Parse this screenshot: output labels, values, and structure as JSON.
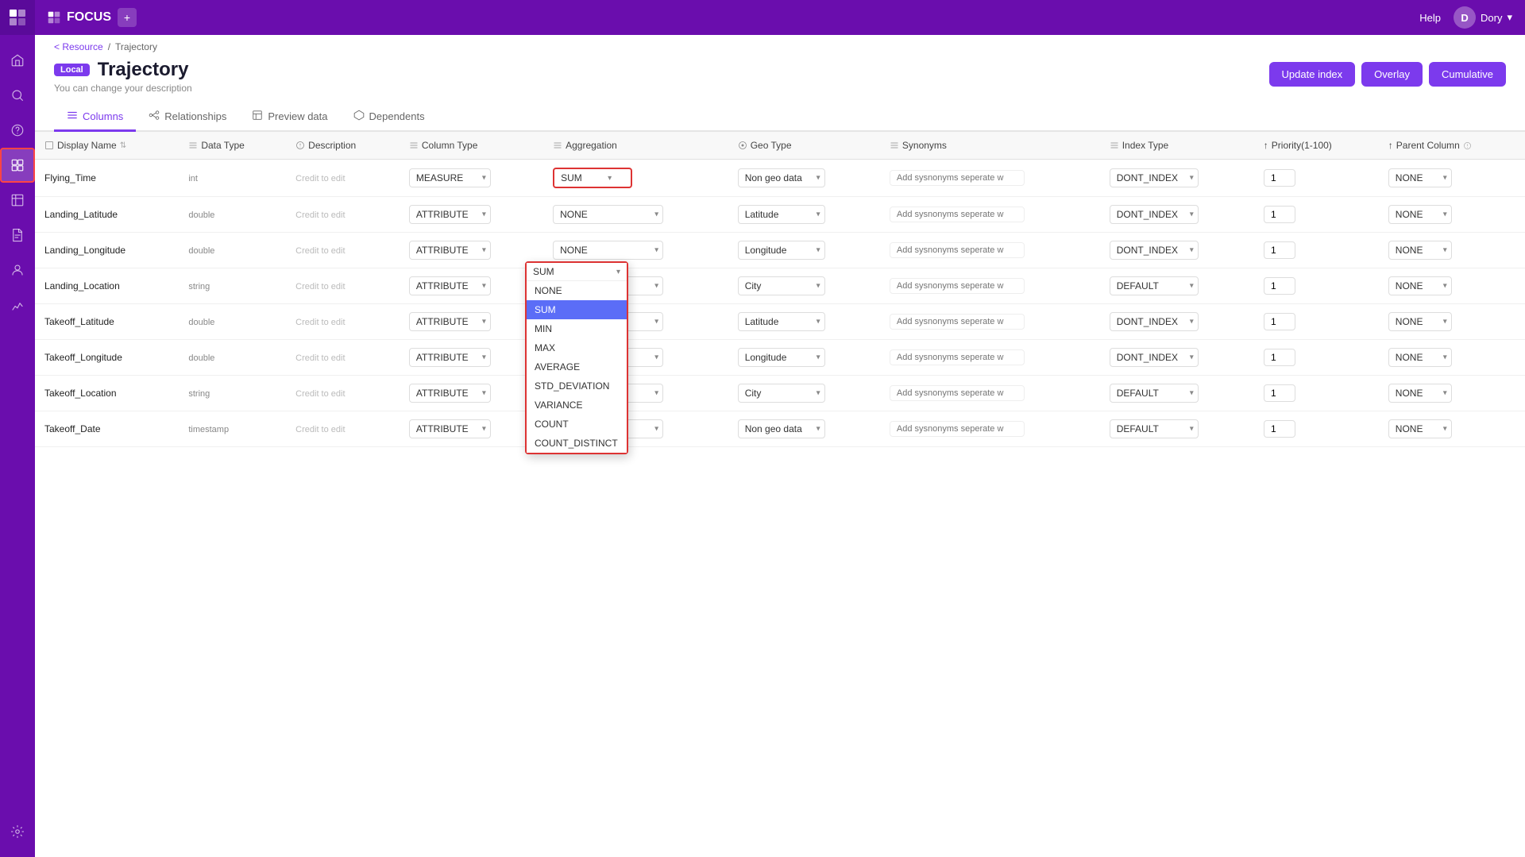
{
  "app": {
    "name": "FOCUS",
    "new_tab_label": "+",
    "help_label": "Help",
    "user_label": "Dory",
    "chevron": "▾"
  },
  "breadcrumb": {
    "back_label": "< Resource",
    "separator": "/",
    "current": "Trajectory"
  },
  "page": {
    "badge": "Local",
    "title": "Trajectory",
    "subtitle": "You can change your description",
    "update_button": "Update index",
    "overlay_button": "Overlay",
    "cumulative_button": "Cumulative"
  },
  "tabs": [
    {
      "id": "columns",
      "label": "Columns",
      "icon": "≡",
      "active": true
    },
    {
      "id": "relationships",
      "label": "Relationships",
      "icon": "⊹",
      "active": false
    },
    {
      "id": "preview",
      "label": "Preview data",
      "icon": "□",
      "active": false
    },
    {
      "id": "dependents",
      "label": "Dependents",
      "icon": "⬡",
      "active": false
    }
  ],
  "table": {
    "columns": [
      {
        "key": "display_name",
        "label": "Display Name",
        "icon": "□",
        "sortable": true
      },
      {
        "key": "data_type",
        "label": "Data Type",
        "icon": "≡"
      },
      {
        "key": "description",
        "label": "Description",
        "icon": "?"
      },
      {
        "key": "column_type",
        "label": "Column Type",
        "icon": "≡"
      },
      {
        "key": "aggregation",
        "label": "Aggregation",
        "icon": "≡"
      },
      {
        "key": "geo_type",
        "label": "Geo Type",
        "icon": "●"
      },
      {
        "key": "synonyms",
        "label": "Synonyms",
        "icon": "≡"
      },
      {
        "key": "index_type",
        "label": "Index Type",
        "icon": "≡"
      },
      {
        "key": "priority",
        "label": "Priority(1-100)",
        "icon": "↑"
      },
      {
        "key": "parent_column",
        "label": "Parent Column",
        "icon": "↑"
      }
    ],
    "rows": [
      {
        "display_name": "Flying_Time",
        "data_type": "int",
        "description": "Credit to edit",
        "column_type": "MEASURE",
        "aggregation": "SUM",
        "aggregation_open": true,
        "geo_type": "Non geo data",
        "synonyms_placeholder": "Add sysnonyms seperate w",
        "index_type": "DONT_INDEX",
        "priority": "1",
        "parent_column": "NONE"
      },
      {
        "display_name": "Landing_Latitude",
        "data_type": "double",
        "description": "Credit to edit",
        "column_type": "ATTRIBUTE",
        "aggregation": "NONE",
        "aggregation_open": false,
        "geo_type": "Latitude",
        "synonyms_placeholder": "Add sysnonyms seperate w",
        "index_type": "DONT_INDEX",
        "priority": "1",
        "parent_column": "NONE"
      },
      {
        "display_name": "Landing_Longitude",
        "data_type": "double",
        "description": "Credit to edit",
        "column_type": "ATTRIBUTE",
        "aggregation": "NONE",
        "aggregation_open": false,
        "geo_type": "Longitude",
        "synonyms_placeholder": "Add sysnonyms seperate w",
        "index_type": "DONT_INDEX",
        "priority": "1",
        "parent_column": "NONE"
      },
      {
        "display_name": "Landing_Location",
        "data_type": "string",
        "description": "Credit to edit",
        "column_type": "ATTRIBUTE",
        "aggregation": "NONE",
        "aggregation_open": false,
        "geo_type": "City",
        "synonyms_placeholder": "Add sysnonyms seperate w",
        "index_type": "DEFAULT",
        "priority": "1",
        "parent_column": "NONE"
      },
      {
        "display_name": "Takeoff_Latitude",
        "data_type": "double",
        "description": "Credit to edit",
        "column_type": "ATTRIBUTE",
        "aggregation": "NONE",
        "aggregation_open": false,
        "geo_type": "Latitude",
        "synonyms_placeholder": "Add sysnonyms seperate w",
        "index_type": "DONT_INDEX",
        "priority": "1",
        "parent_column": "NONE"
      },
      {
        "display_name": "Takeoff_Longitude",
        "data_type": "double",
        "description": "Credit to edit",
        "column_type": "ATTRIBUTE",
        "aggregation": "NONE",
        "aggregation_open": false,
        "geo_type": "Longitude",
        "synonyms_placeholder": "Add sysnonyms seperate w",
        "index_type": "DONT_INDEX",
        "priority": "1",
        "parent_column": "NONE"
      },
      {
        "display_name": "Takeoff_Location",
        "data_type": "string",
        "description": "Credit to edit",
        "column_type": "ATTRIBUTE",
        "aggregation": "NONE",
        "aggregation_open": false,
        "geo_type": "City",
        "synonyms_placeholder": "Add sysnonyms seperate w",
        "index_type": "DEFAULT",
        "priority": "1",
        "parent_column": "NONE"
      },
      {
        "display_name": "Takeoff_Date",
        "data_type": "timestamp",
        "description": "Credit to edit",
        "column_type": "ATTRIBUTE",
        "aggregation": "NONE",
        "aggregation_open": false,
        "geo_type": "Non geo data",
        "synonyms_placeholder": "Add sysnonyms seperate w",
        "index_type": "DEFAULT",
        "priority": "1",
        "parent_column": "NONE"
      }
    ],
    "aggregation_options": [
      "NONE",
      "SUM",
      "MIN",
      "MAX",
      "AVERAGE",
      "STD_DEVIATION",
      "VARIANCE",
      "COUNT",
      "COUNT_DISTINCT"
    ]
  },
  "sidebar": {
    "icons": [
      {
        "id": "home",
        "symbol": "⌂",
        "active": false
      },
      {
        "id": "search",
        "symbol": "🔍",
        "active": false
      },
      {
        "id": "help",
        "symbol": "?",
        "active": false
      },
      {
        "id": "datasets",
        "symbol": "▦",
        "active": true
      },
      {
        "id": "library",
        "symbol": "📋",
        "active": false
      },
      {
        "id": "reports",
        "symbol": "📄",
        "active": false
      },
      {
        "id": "users",
        "symbol": "👤",
        "active": false
      },
      {
        "id": "analytics",
        "symbol": "📈",
        "active": false
      },
      {
        "id": "settings",
        "symbol": "⚙",
        "active": false
      }
    ]
  }
}
